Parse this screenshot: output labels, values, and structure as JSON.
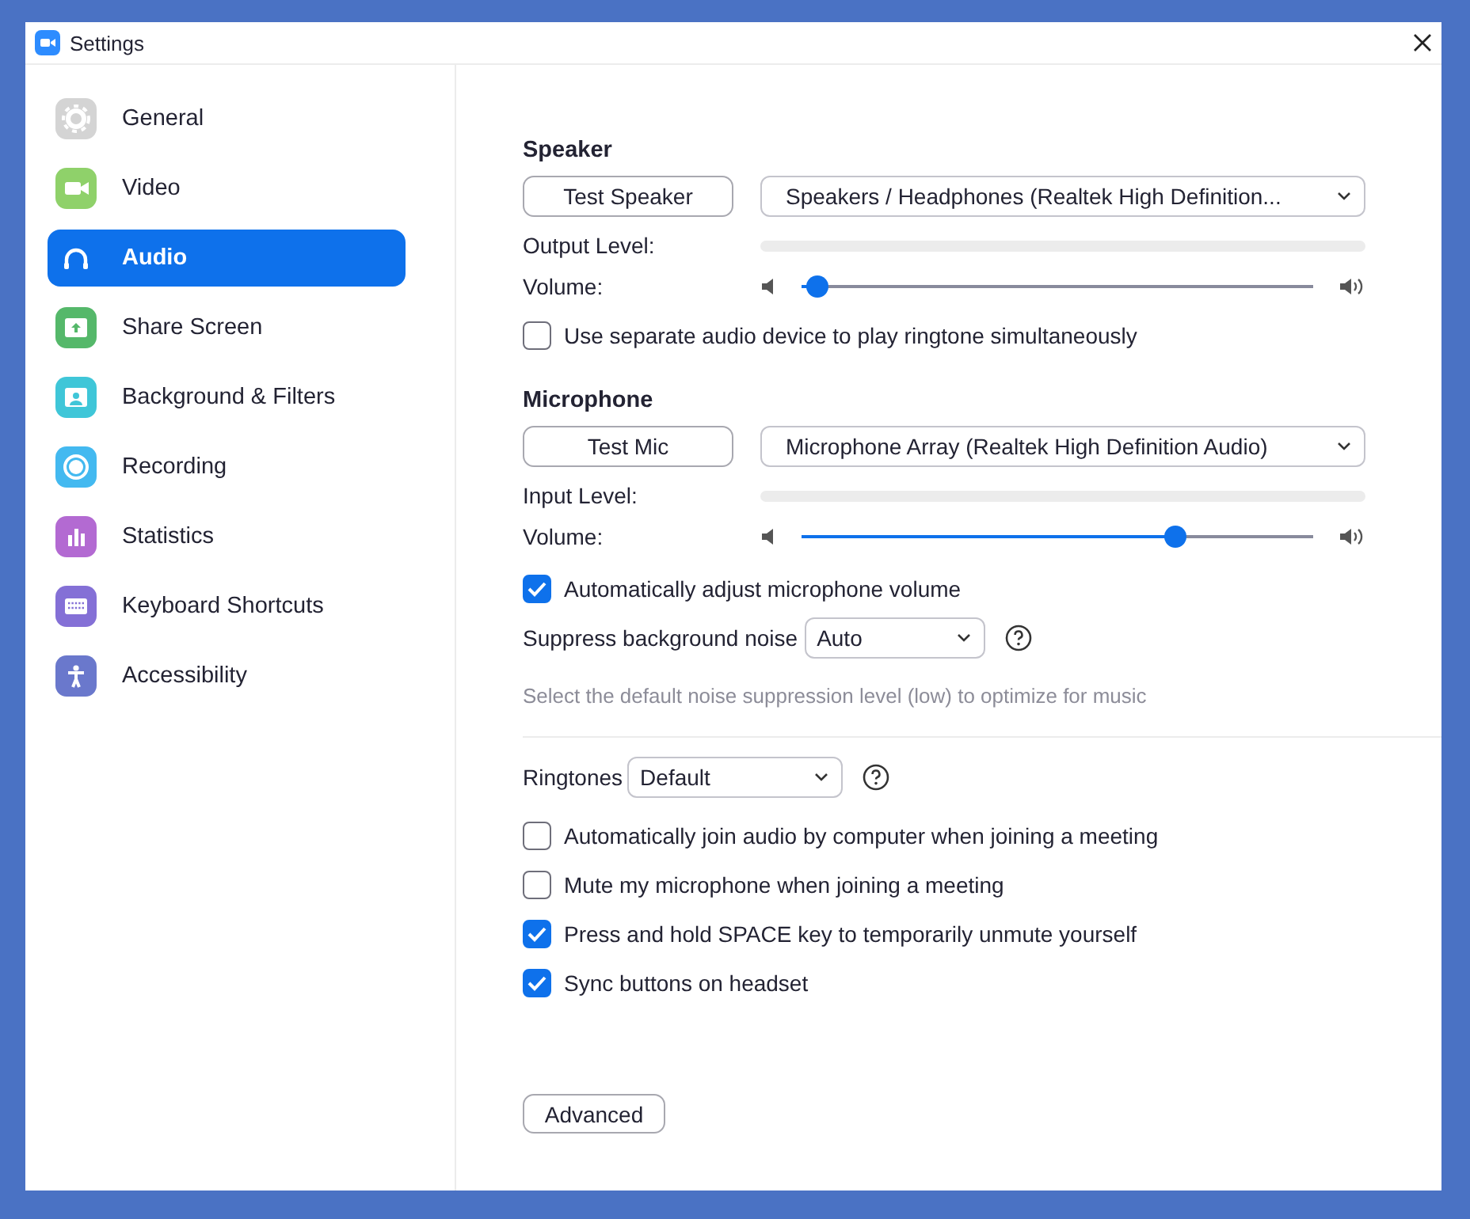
{
  "window": {
    "title": "Settings"
  },
  "sidebar": {
    "items": [
      {
        "label": "General",
        "kind": "general",
        "selected": false
      },
      {
        "label": "Video",
        "kind": "video",
        "selected": false
      },
      {
        "label": "Audio",
        "kind": "audio",
        "selected": true
      },
      {
        "label": "Share Screen",
        "kind": "share",
        "selected": false
      },
      {
        "label": "Background & Filters",
        "kind": "background",
        "selected": false
      },
      {
        "label": "Recording",
        "kind": "recording",
        "selected": false
      },
      {
        "label": "Statistics",
        "kind": "statistics",
        "selected": false
      },
      {
        "label": "Keyboard Shortcuts",
        "kind": "keyboard",
        "selected": false
      },
      {
        "label": "Accessibility",
        "kind": "accessibility",
        "selected": false
      }
    ]
  },
  "speaker": {
    "heading": "Speaker",
    "test_button": "Test Speaker",
    "device": "Speakers / Headphones (Realtek High Definition...",
    "level_label": "Output Level:",
    "meter": {
      "level": 0
    },
    "volume_label": "Volume:",
    "volume": {
      "level": 0.03
    }
  },
  "separate_device": {
    "label": "Use separate audio device to play ringtone simultaneously",
    "checked": false
  },
  "microphone": {
    "heading": "Microphone",
    "test_button": "Test Mic",
    "device": "Microphone Array (Realtek High Definition Audio)",
    "level_label": "Input Level:",
    "meter": {
      "level": 0
    },
    "volume_label": "Volume:",
    "volume": {
      "level": 0.73
    }
  },
  "auto_adjust": {
    "label": "Automatically adjust microphone volume",
    "checked": true
  },
  "suppress_noise": {
    "label": "Suppress background noise",
    "value": "Auto"
  },
  "noise_hint": "Select the default noise suppression level (low) to optimize for music",
  "ringtones": {
    "label": "Ringtones",
    "value": "Default"
  },
  "options": [
    {
      "label": "Automatically join audio by computer when joining a meeting",
      "checked": false
    },
    {
      "label": "Mute my microphone when joining a meeting",
      "checked": false
    },
    {
      "label": "Press and hold SPACE key to temporarily unmute yourself",
      "checked": true
    },
    {
      "label": "Sync buttons on headset",
      "checked": true
    }
  ],
  "advanced_button": "Advanced"
}
